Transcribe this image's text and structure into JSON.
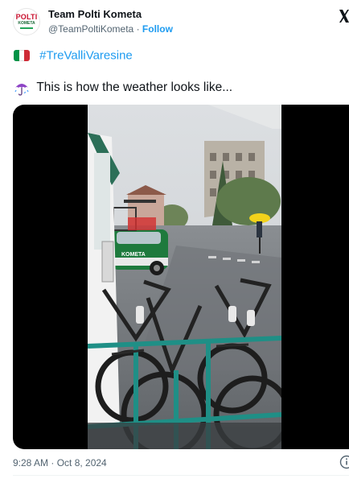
{
  "tweet": {
    "author_name": "Team Polti Kometa",
    "handle": "@TeamPoltiKometa",
    "separator": "·",
    "follow_label": "Follow",
    "avatar_text_top": "POLTI",
    "avatar_text_bottom": "KOMETA",
    "hashtag": "#TreValliVaresine",
    "text": "This is how the weather looks like...",
    "timestamp": "9:28 AM · Oct 8, 2024",
    "flag_colors": [
      "#009246",
      "#ffffff",
      "#ce2b37"
    ],
    "emoji_umbrella": "umbrella-with-rain-icon",
    "video_car_label": "KOMETA",
    "accent_color": "#1d9bf0"
  }
}
